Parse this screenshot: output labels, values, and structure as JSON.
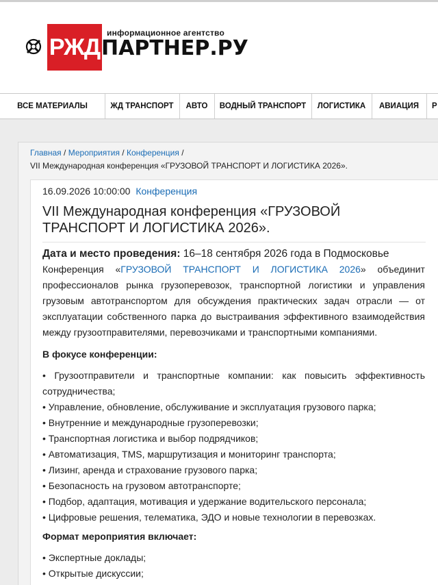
{
  "header": {
    "logo_red": "РЖД",
    "logo_tagline": "информационное агентство",
    "logo_name": "ПАРТНЕР.РУ"
  },
  "nav": {
    "items": [
      "ВСЕ МАТЕРИАЛЫ",
      "ЖД ТРАНСПОРТ",
      "АВТО",
      "ВОДНЫЙ ТРАНСПОРТ",
      "ЛОГИСТИКА",
      "АВИАЦИЯ",
      "Р"
    ]
  },
  "breadcrumb": {
    "home": "Главная",
    "events": "Мероприятия",
    "conferences": "Конференция",
    "sep": "/",
    "current": "VII Международная конференция «ГРУЗОВОЙ ТРАНСПОРТ И ЛОГИСТИКА 2026»."
  },
  "article": {
    "datetime": "16.09.2026 10:00:00",
    "category": "Конференция",
    "title": "VII Международная конференция «ГРУЗОВОЙ ТРАНСПОРТ И ЛОГИСТИКА 2026».",
    "place_label": "Дата и место проведения:",
    "place_value": " 16–18 сентября 2026 года в Подмосковье",
    "intro_before": "Конференция «",
    "intro_link": "ГРУЗОВОЙ ТРАНСПОРТ И ЛОГИСТИКА 2026",
    "intro_after": "» объединит профессионалов рынка грузоперевозок, транспортной логистики и управления грузовым автотранспортом для обсуждения практических задач отрасли — от эксплуатации собственного парка до выстраивания эффективного взаимодействия между грузоотправителями, перевозчиками и транспортными компаниями.",
    "focus_heading": "В фокусе конференции:",
    "focus_items": [
      "• Грузоотправители и транспортные компании: как повысить эффективность сотрудничества;",
      "• Управление, обновление, обслуживание и эксплуатация грузового парка;",
      "• Внутренние и международные грузоперевозки;",
      "• Транспортная логистика и выбор подрядчиков;",
      "• Автоматизация, TMS, маршрутизация и мониторинг транспорта;",
      "• Лизинг, аренда и страхование грузового парка;",
      "• Безопасность на грузовом автотранспорте;",
      "• Подбор, адаптация, мотивация и удержание водительского персонала;",
      "• Цифровые решения, телематика, ЭДО и новые технологии в перевозках."
    ],
    "format_heading": "Формат мероприятия включает:",
    "format_items": [
      "• Экспертные доклады;",
      "• Открытые дискуссии;"
    ]
  },
  "colors": {
    "brand_red": "#d91f26",
    "link_blue": "#1a6cb5"
  }
}
